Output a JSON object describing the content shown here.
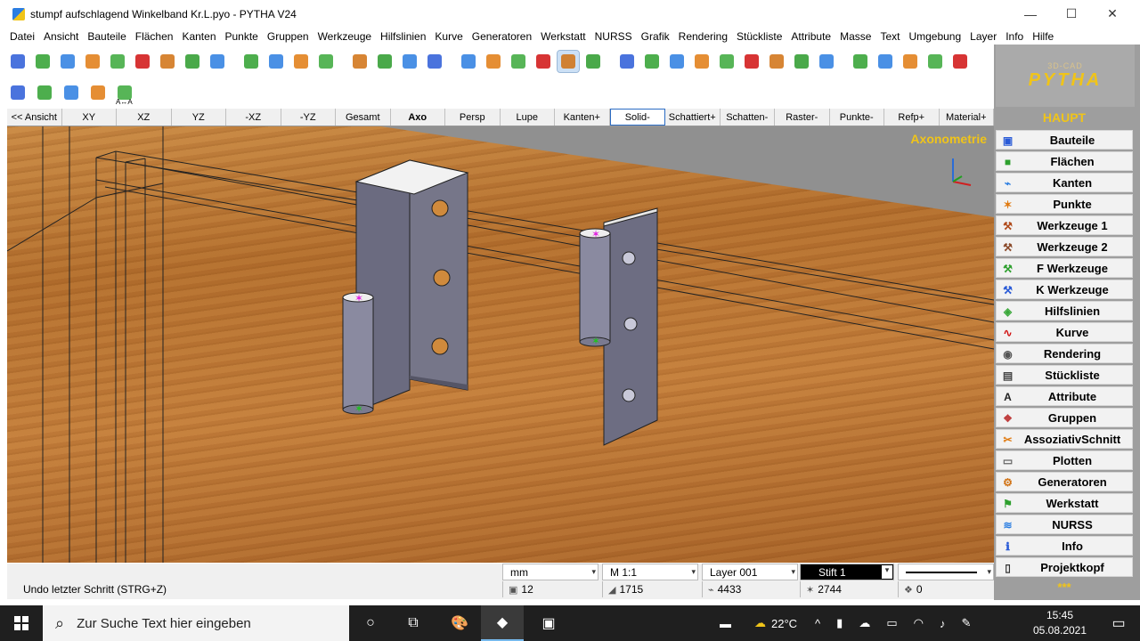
{
  "window": {
    "title": "stumpf aufschlagend Winkelband Kr.L.pyo - PYTHA V24",
    "minimize_glyph": "—",
    "maximize_glyph": "☐",
    "close_glyph": "✕"
  },
  "menu": [
    "Datei",
    "Ansicht",
    "Bauteile",
    "Flächen",
    "Kanten",
    "Punkte",
    "Gruppen",
    "Werkzeuge",
    "Hilfslinien",
    "Kurve",
    "Generatoren",
    "Werkstatt",
    "NURSS",
    "Grafik",
    "Rendering",
    "Stückliste",
    "Attribute",
    "Masse",
    "Text",
    "Umgebung",
    "Layer",
    "Info",
    "Hilfe"
  ],
  "toolbar_icons": {
    "row1": [
      "cube-icon",
      "face-icon",
      "edge-icon",
      "points-icon",
      "helpline-icon",
      "curve-icon",
      "gear-icon",
      "tool-icon",
      "nurss-icon",
      "sep",
      "tool1-icon",
      "tool2-icon",
      "ftool-icon",
      "ktool-icon",
      "sep",
      "camera-icon",
      "render-icon",
      "eye-icon",
      "plot-icon",
      "sep",
      "export-icon",
      "import-icon",
      "fill-icon",
      "cup-icon",
      "pick-icon",
      "redo-icon",
      "sep",
      "attr-icon",
      "list-icon",
      "rows-icon",
      "counter-icon",
      "copy-icon",
      "hatch-icon",
      "layer-icon",
      "tree-icon",
      "info-icon",
      "sep",
      "refresh-icon",
      "delete-icon",
      "move-icon",
      "scale-icon",
      "rotate-icon"
    ],
    "row2": [
      "material-icon",
      "brush-icon",
      "paint-icon",
      "fill2-icon",
      "cut-icon"
    ],
    "row2_caption": "A↔A"
  },
  "view_buttons": [
    {
      "label": "<< Ansicht"
    },
    {
      "label": "XY"
    },
    {
      "label": "XZ"
    },
    {
      "label": "YZ"
    },
    {
      "label": "-XZ"
    },
    {
      "label": "-YZ"
    },
    {
      "label": "Gesamt"
    },
    {
      "label": "Axo",
      "bold": true
    },
    {
      "label": "Persp"
    },
    {
      "label": "Lupe"
    },
    {
      "label": "Kanten+"
    },
    {
      "label": "Solid-",
      "selected": true
    },
    {
      "label": "Schattiert+"
    },
    {
      "label": "Schatten-"
    },
    {
      "label": "Raster-"
    },
    {
      "label": "Punkte-"
    },
    {
      "label": "Refp+"
    },
    {
      "label": "Material+"
    }
  ],
  "viewport": {
    "mode_label": "Axonometrie"
  },
  "status": {
    "unit": "mm",
    "scale": "M 1:1",
    "layer": "Layer 001",
    "pen": "Stift 1",
    "undo_hint": "Undo letzter Schritt (STRG+Z)",
    "count_parts": "12",
    "count_faces": "1715",
    "count_edges": "4433",
    "count_points": "2744",
    "count_groups": "0"
  },
  "right_panel": {
    "logo_small": "3D-CAD",
    "logo_main": "PYTHA",
    "heading": "HAUPT",
    "items": [
      {
        "label": "Bauteile",
        "icon": "cube-icon",
        "glyph": "▣",
        "color": "#2a5bd7"
      },
      {
        "label": "Flächen",
        "icon": "face-icon",
        "glyph": "■",
        "color": "#2ea02e"
      },
      {
        "label": "Kanten",
        "icon": "edge-icon",
        "glyph": "⌁",
        "color": "#2a7de1"
      },
      {
        "label": "Punkte",
        "icon": "points-icon",
        "glyph": "✶",
        "color": "#e07a10"
      },
      {
        "label": "Werkzeuge 1",
        "icon": "tool1-icon",
        "glyph": "⚒",
        "color": "#b04a1a"
      },
      {
        "label": "Werkzeuge 2",
        "icon": "tool2-icon",
        "glyph": "⚒",
        "color": "#8a4a2a"
      },
      {
        "label": "F Werkzeuge",
        "icon": "ftool-icon",
        "glyph": "⚒",
        "color": "#2ea02e"
      },
      {
        "label": "K Werkzeuge",
        "icon": "ktool-icon",
        "glyph": "⚒",
        "color": "#2a5bd7"
      },
      {
        "label": "Hilfslinien",
        "icon": "helpline-icon",
        "glyph": "◈",
        "color": "#3aa83a"
      },
      {
        "label": "Kurve",
        "icon": "curve-icon",
        "glyph": "∿",
        "color": "#d01010"
      },
      {
        "label": "Rendering",
        "icon": "render-icon",
        "glyph": "◉",
        "color": "#555"
      },
      {
        "label": "Stückliste",
        "icon": "list-icon",
        "glyph": "▤",
        "color": "#444"
      },
      {
        "label": "Attribute",
        "icon": "attr-icon",
        "glyph": "A",
        "color": "#222"
      },
      {
        "label": "Gruppen",
        "icon": "group-icon",
        "glyph": "❖",
        "color": "#c04040"
      },
      {
        "label": "AssoziativSchnitt",
        "icon": "assoc-icon",
        "glyph": "✂",
        "color": "#e07a10"
      },
      {
        "label": "Plotten",
        "icon": "plot-icon",
        "glyph": "▭",
        "color": "#666"
      },
      {
        "label": "Generatoren",
        "icon": "gear-icon",
        "glyph": "⚙",
        "color": "#d07010"
      },
      {
        "label": "Werkstatt",
        "icon": "workshop-icon",
        "glyph": "⚑",
        "color": "#2ea02e"
      },
      {
        "label": "NURSS",
        "icon": "nurss-icon",
        "glyph": "≋",
        "color": "#2a7de1"
      },
      {
        "label": "Info",
        "icon": "info-icon",
        "glyph": "ℹ",
        "color": "#2a5bd7"
      },
      {
        "label": "Projektkopf",
        "icon": "project-icon",
        "glyph": "▯",
        "color": "#333"
      }
    ],
    "footer": "***"
  },
  "taskbar": {
    "search_placeholder": "Zur Suche Text hier eingeben",
    "weather": "22°C",
    "time": "15:45",
    "date": "05.08.2021"
  }
}
